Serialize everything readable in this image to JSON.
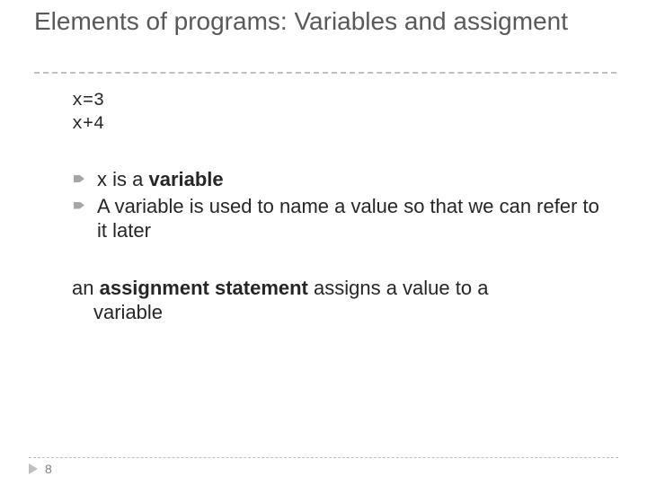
{
  "title": "Elements of programs: Variables and assigment",
  "code": {
    "line1": "x=3",
    "line2": "x+4"
  },
  "bullets": [
    {
      "pre": "x is a ",
      "bold": "variable",
      "post": ""
    },
    {
      "pre": "A variable is used to name a value so that we can refer to it later",
      "bold": "",
      "post": ""
    }
  ],
  "para": {
    "pre": "an ",
    "bold": "assignment statement",
    "post_line1": " assigns a value to a",
    "post_line2": "variable"
  },
  "page_number": "8"
}
